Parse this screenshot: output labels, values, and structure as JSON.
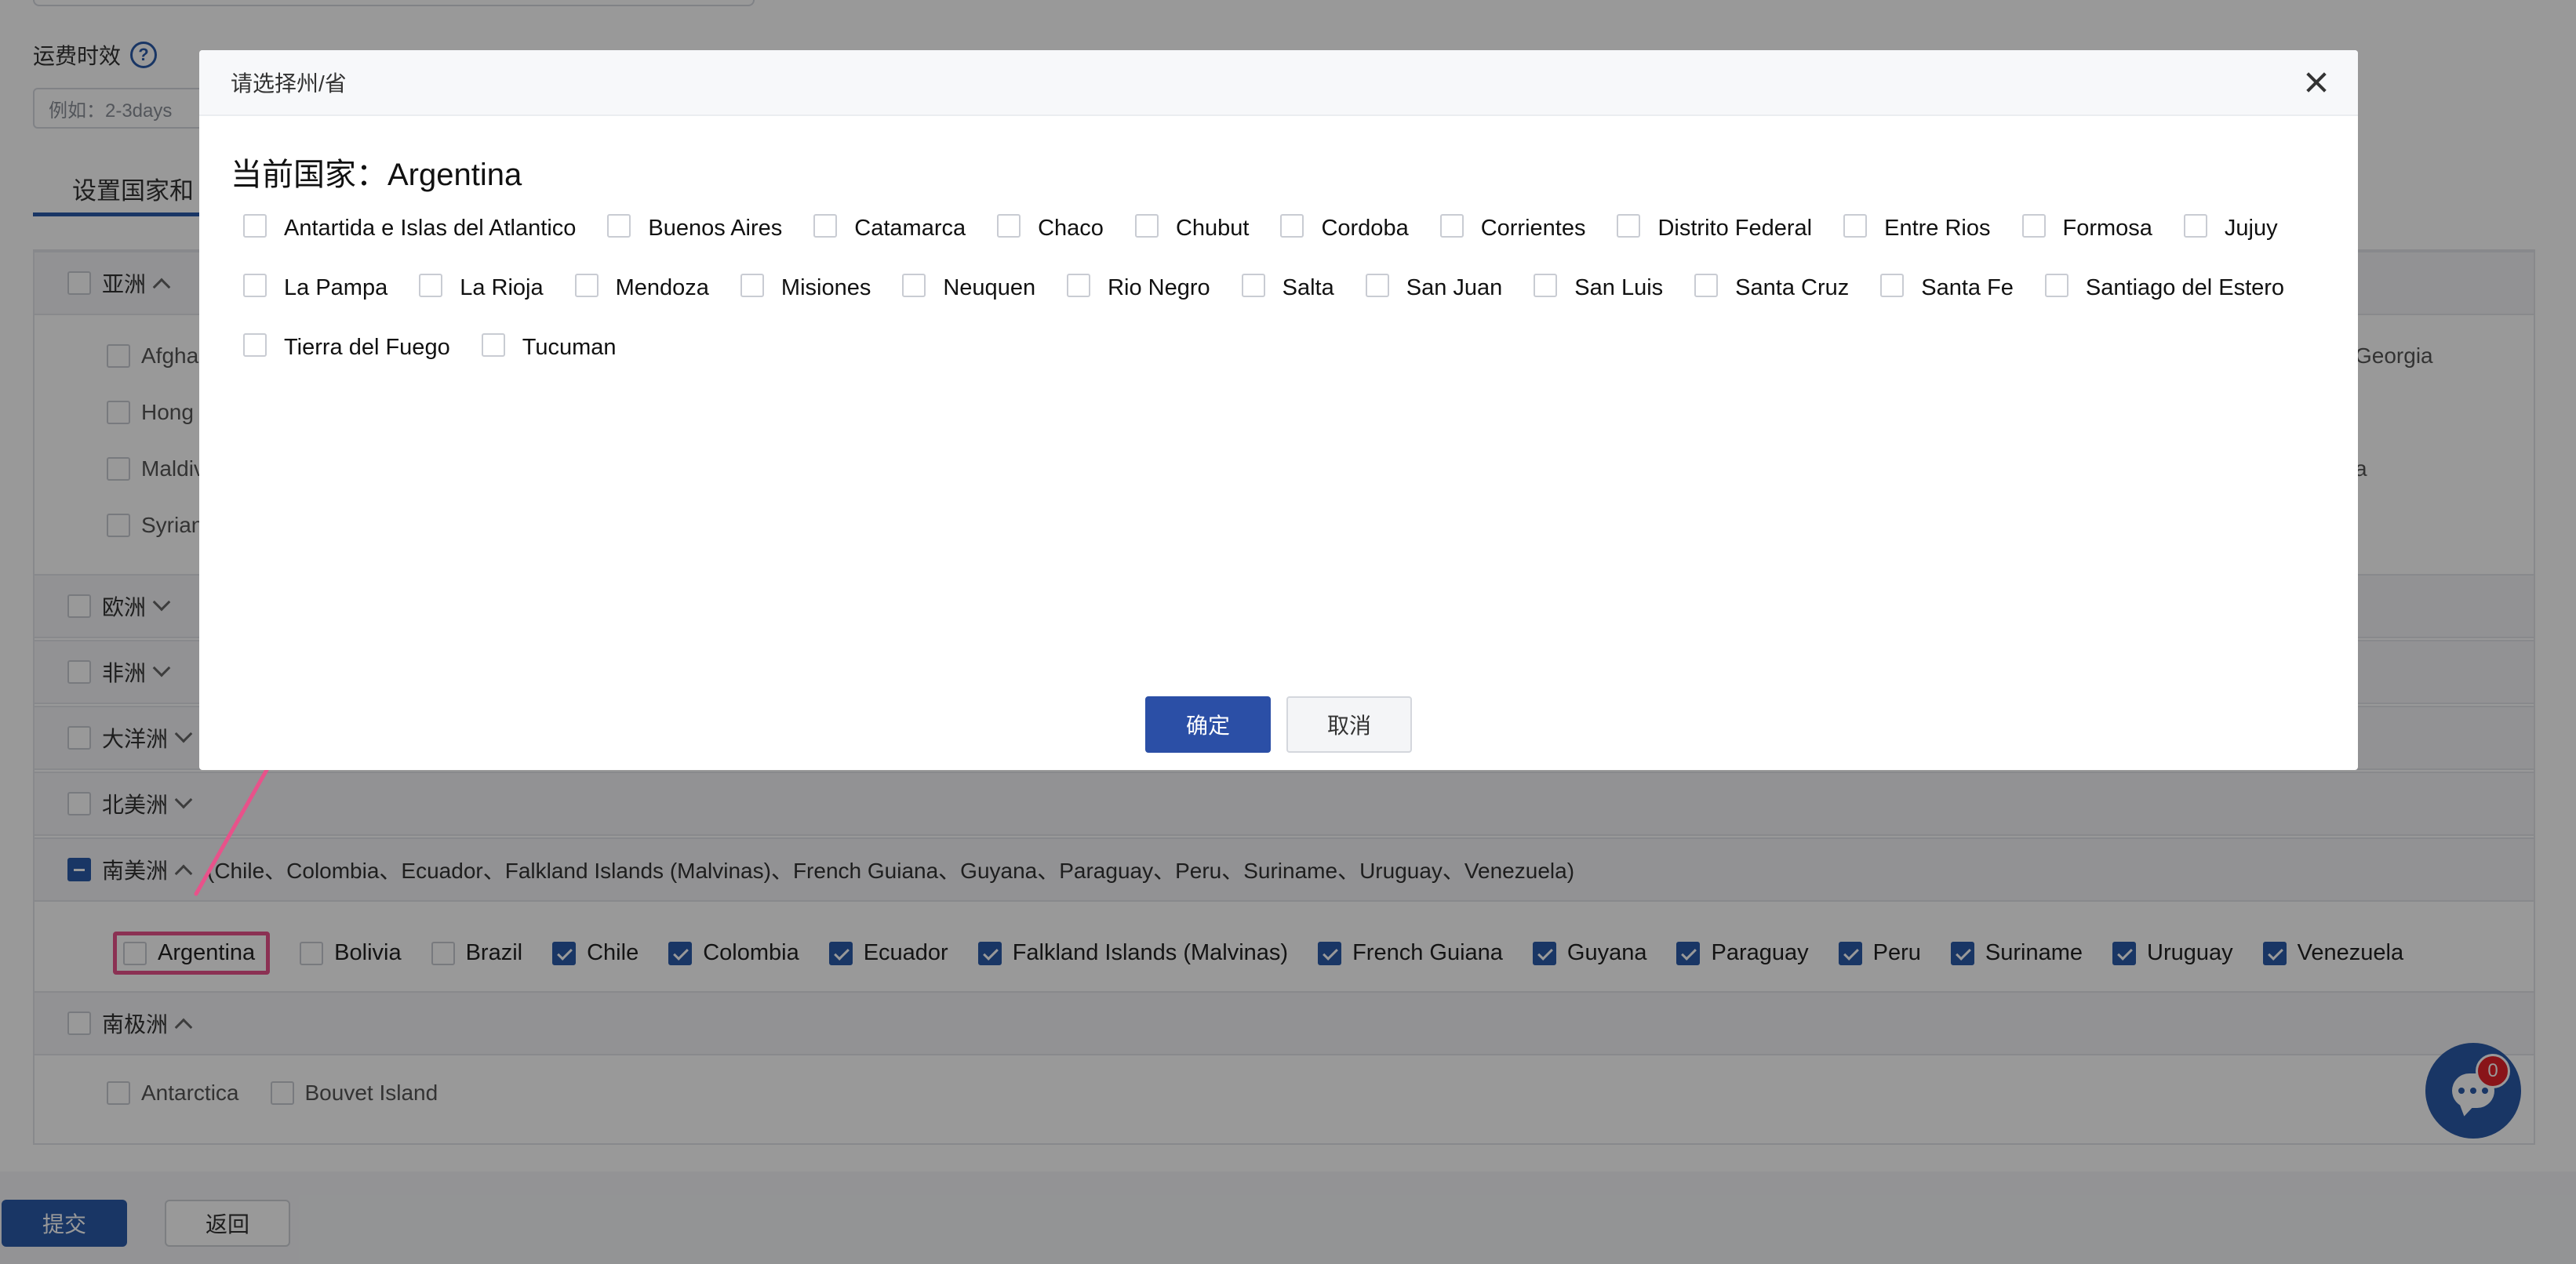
{
  "background": {
    "field_label": "运费时效",
    "field_placeholder": "例如：2-3days",
    "tab_label": "设置国家和",
    "regions": {
      "asia": "亚洲",
      "europe": "欧洲",
      "africa": "非洲",
      "oceania": "大洋洲",
      "north_america": "北美洲",
      "south_america": "南美洲",
      "antarctica": "南极洲"
    },
    "asia_countries_left": [
      "Afgha",
      "Hong",
      "Maldiv",
      "Syrian"
    ],
    "asia_countries_right": [
      "Georgia",
      "a"
    ],
    "south_america_summary": "(Chile、Colombia、Ecuador、Falkland Islands (Malvinas)、French Guiana、Guyana、Paraguay、Peru、Suriname、Uruguay、Venezuela)",
    "south_america_countries": [
      {
        "name": "Argentina",
        "checked": false
      },
      {
        "name": "Bolivia",
        "checked": false
      },
      {
        "name": "Brazil",
        "checked": false
      },
      {
        "name": "Chile",
        "checked": true
      },
      {
        "name": "Colombia",
        "checked": true
      },
      {
        "name": "Ecuador",
        "checked": true
      },
      {
        "name": "Falkland Islands (Malvinas)",
        "checked": true
      },
      {
        "name": "French Guiana",
        "checked": true
      },
      {
        "name": "Guyana",
        "checked": true
      },
      {
        "name": "Paraguay",
        "checked": true
      },
      {
        "name": "Peru",
        "checked": true
      },
      {
        "name": "Suriname",
        "checked": true
      },
      {
        "name": "Uruguay",
        "checked": true
      },
      {
        "name": "Venezuela",
        "checked": true
      }
    ],
    "antarctica_countries": [
      "Antarctica",
      "Bouvet Island"
    ],
    "submit_label": "提交",
    "back_label": "返回",
    "chat_badge_count": "0"
  },
  "modal": {
    "title": "请选择州/省",
    "current_country": "当前国家：Argentina",
    "provinces": [
      "Antartida e Islas del Atlantico",
      "Buenos Aires",
      "Catamarca",
      "Chaco",
      "Chubut",
      "Cordoba",
      "Corrientes",
      "Distrito Federal",
      "Entre Rios",
      "Formosa",
      "Jujuy",
      "La Pampa",
      "La Rioja",
      "Mendoza",
      "Misiones",
      "Neuquen",
      "Rio Negro",
      "Salta",
      "San Juan",
      "San Luis",
      "Santa Cruz",
      "Santa Fe",
      "Santiago del Estero",
      "Tierra del Fuego",
      "Tucuman"
    ],
    "confirm_label": "确定",
    "cancel_label": "取消"
  },
  "colors": {
    "primary": "#2b5aa8",
    "highlight": "#e8528a",
    "badge": "#e5222b"
  }
}
